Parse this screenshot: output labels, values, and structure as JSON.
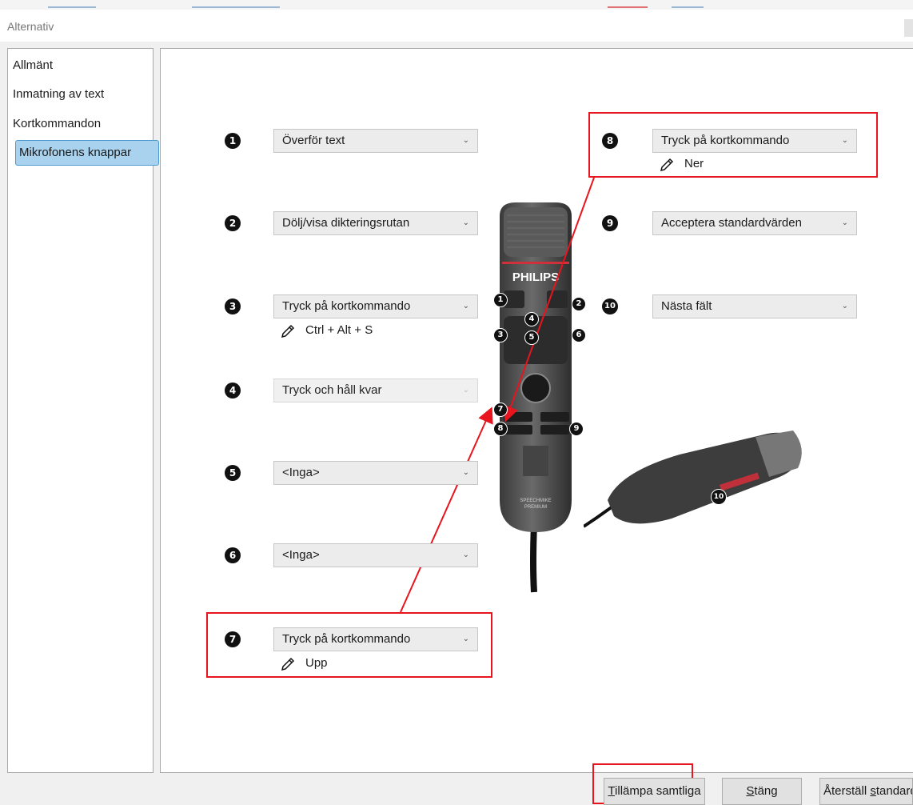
{
  "window": {
    "title": "Alternativ"
  },
  "sidebar": {
    "items": [
      {
        "label": "Allmänt"
      },
      {
        "label": "Inmatning av text"
      },
      {
        "label": "Kortkommandon"
      },
      {
        "label": "Mikrofonens knappar"
      }
    ]
  },
  "buttons": [
    {
      "number": "1",
      "value": "Överför text",
      "hint": ""
    },
    {
      "number": "2",
      "value": "Dölj/visa dikteringsrutan",
      "hint": ""
    },
    {
      "number": "3",
      "value": "Tryck på kortkommando",
      "hint": "Ctrl + Alt + S"
    },
    {
      "number": "4",
      "value": "Tryck och håll kvar",
      "hint": ""
    },
    {
      "number": "5",
      "value": "<Inga>",
      "hint": ""
    },
    {
      "number": "6",
      "value": "<Inga>",
      "hint": ""
    },
    {
      "number": "7",
      "value": "Tryck på kortkommando",
      "hint": "Upp"
    },
    {
      "number": "8",
      "value": "Tryck på kortkommando",
      "hint": "Ner"
    },
    {
      "number": "9",
      "value": "Acceptera standardvärden",
      "hint": ""
    },
    {
      "number": "10",
      "value": "Nästa fält",
      "hint": ""
    }
  ],
  "device": {
    "brand": "PHILIPS",
    "model": "SPEECHMIKE PREMIUM",
    "model_line1": "SPEECHMIKE",
    "model_line2": "PREMIUM",
    "markers": [
      "1",
      "2",
      "3",
      "4",
      "5",
      "6",
      "7",
      "8",
      "9",
      "10"
    ]
  },
  "footer": {
    "apply_all": {
      "accel": "T",
      "rest": "illämpa samtliga"
    },
    "close": {
      "accel": "S",
      "rest": "täng"
    },
    "reset": {
      "pre": "Återställ ",
      "accel": "s",
      "rest": "tandard"
    }
  },
  "colors": {
    "highlight": "#e8141e",
    "selected": "#a9d2ef",
    "accent": "#4b9bd1"
  }
}
